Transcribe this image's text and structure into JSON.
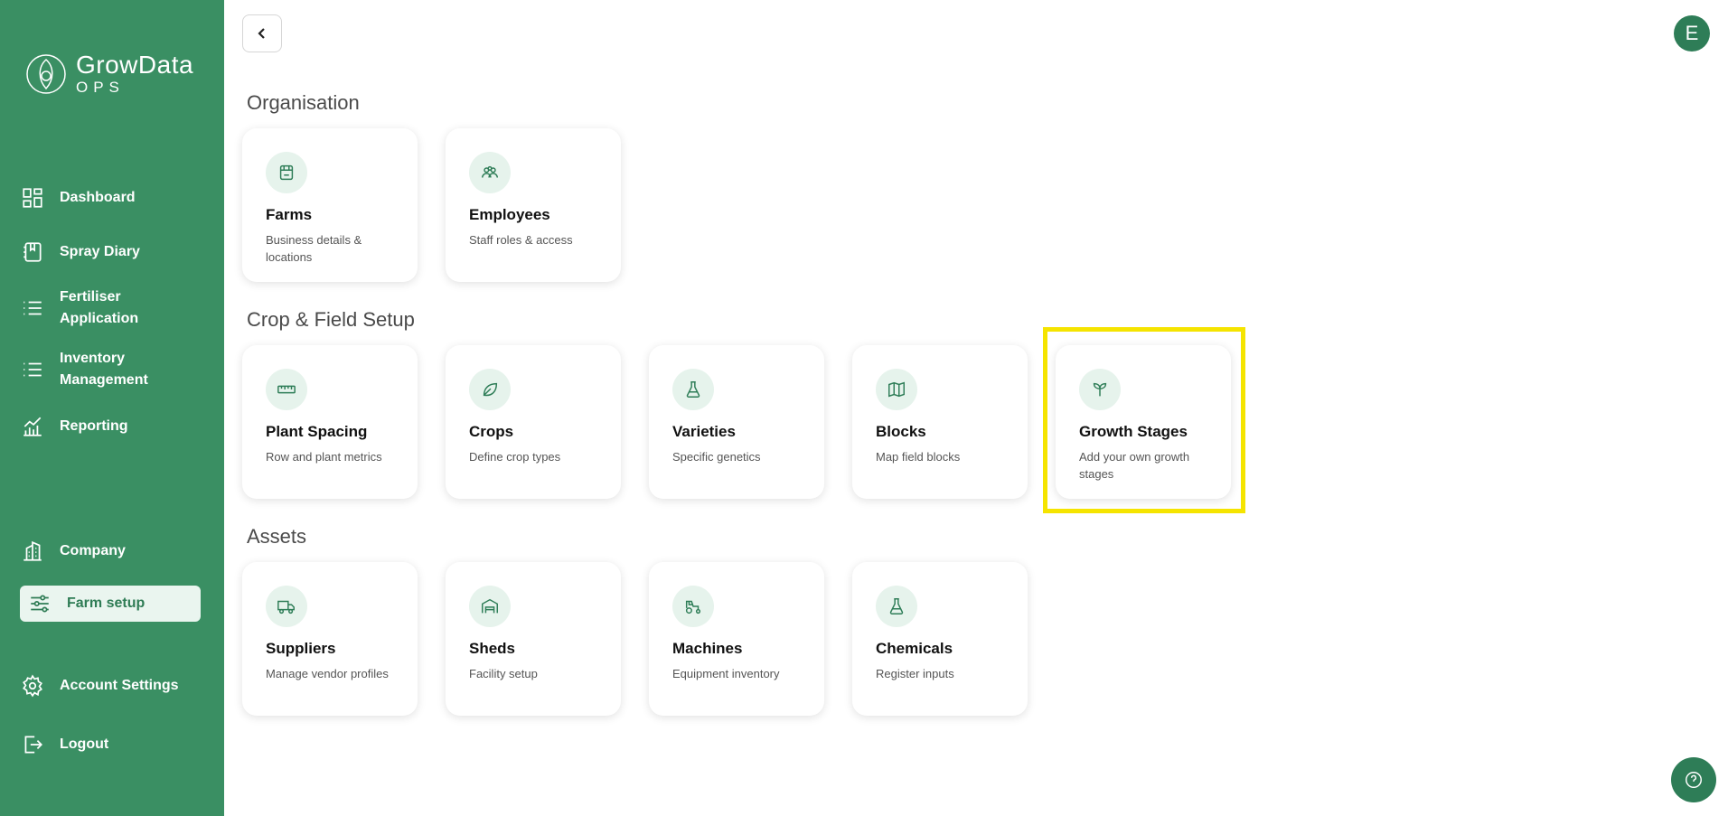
{
  "app": {
    "name": "GrowData",
    "sub": "OPS"
  },
  "sidebar": {
    "items": [
      {
        "label": "Dashboard",
        "icon": "dashboard-icon"
      },
      {
        "label": "Spray Diary",
        "icon": "diary-icon"
      },
      {
        "label": "Fertiliser Application",
        "icon": "list-icon"
      },
      {
        "label": "Inventory Management",
        "icon": "list-icon"
      },
      {
        "label": "Reporting",
        "icon": "chart-icon"
      },
      {
        "label": "Company",
        "icon": "building-icon"
      },
      {
        "label": "Farm setup",
        "icon": "sliders-icon"
      },
      {
        "label": "Account Settings",
        "icon": "gear-icon"
      },
      {
        "label": "Logout",
        "icon": "logout-icon"
      }
    ],
    "active": "Farm setup"
  },
  "user": {
    "initial": "E"
  },
  "sections": {
    "organisation": {
      "title": "Organisation",
      "cards": [
        {
          "title": "Farms",
          "desc": "Business details & locations",
          "icon": "store-icon"
        },
        {
          "title": "Employees",
          "desc": "Staff roles & access",
          "icon": "users-icon"
        }
      ]
    },
    "crop": {
      "title": "Crop & Field Setup",
      "cards": [
        {
          "title": "Plant Spacing",
          "desc": "Row and plant metrics",
          "icon": "ruler-icon"
        },
        {
          "title": "Crops",
          "desc": "Define crop types",
          "icon": "leaf-icon"
        },
        {
          "title": "Varieties",
          "desc": "Specific genetics",
          "icon": "flask-icon"
        },
        {
          "title": "Blocks",
          "desc": "Map field blocks",
          "icon": "map-icon"
        },
        {
          "title": "Growth Stages",
          "desc": "Add your own growth stages",
          "icon": "sprout-icon"
        }
      ]
    },
    "assets": {
      "title": "Assets",
      "cards": [
        {
          "title": "Suppliers",
          "desc": "Manage vendor profiles",
          "icon": "truck-icon"
        },
        {
          "title": "Sheds",
          "desc": "Facility setup",
          "icon": "warehouse-icon"
        },
        {
          "title": "Machines",
          "desc": "Equipment inventory",
          "icon": "tractor-icon"
        },
        {
          "title": "Chemicals",
          "desc": "Register inputs",
          "icon": "flask-icon"
        }
      ]
    }
  },
  "colors": {
    "sidebar": "#3a8f63",
    "accent": "#2e7d57",
    "highlight": "#f5e400"
  }
}
